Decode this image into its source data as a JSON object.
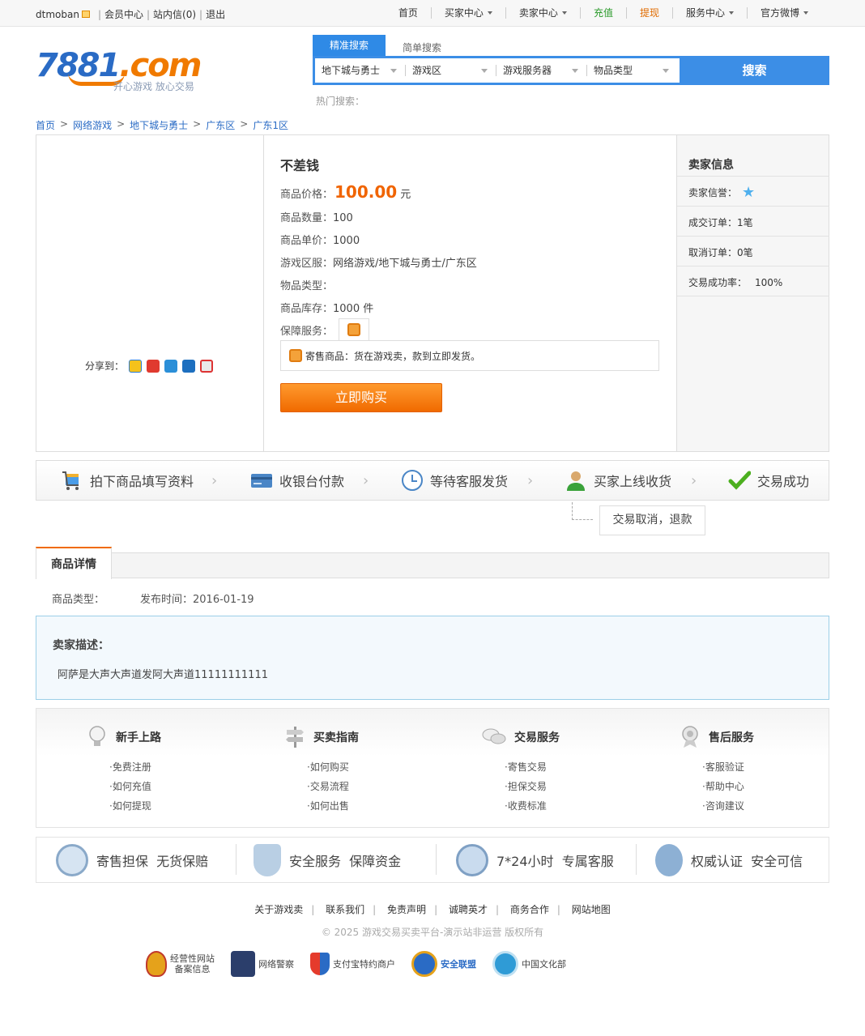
{
  "topbar": {
    "username": "dtmoban",
    "member_center": "会员中心",
    "messages": "站内信(0)",
    "logout": "退出",
    "nav": [
      {
        "label": "首页",
        "dropdown": false
      },
      {
        "label": "买家中心",
        "dropdown": true
      },
      {
        "label": "卖家中心",
        "dropdown": true
      },
      {
        "label": "充值",
        "dropdown": false,
        "color": "#2a9a2a"
      },
      {
        "label": "提现",
        "dropdown": false,
        "color": "#e06b00"
      },
      {
        "label": "服务中心",
        "dropdown": true
      },
      {
        "label": "官方微博",
        "dropdown": true
      }
    ]
  },
  "logo": {
    "brand_number": "7881",
    "brand_suffix": ".com",
    "slogan": "开心游戏 放心交易"
  },
  "search": {
    "tab_precise": "精准搜索",
    "tab_simple": "简单搜索",
    "fields": [
      "地下城与勇士",
      "游戏区",
      "游戏服务器",
      "物品类型"
    ],
    "button": "搜索",
    "hot_label": "热门搜索："
  },
  "breadcrumb": [
    "首页",
    "网络游戏",
    "地下城与勇士",
    "广东区",
    "广东1区"
  ],
  "product": {
    "share_label": "分享到：",
    "title": "不差钱",
    "price_label": "商品价格：",
    "price": "100.00",
    "price_unit": "元",
    "quantity_label": "商品数量：",
    "quantity": "100",
    "unit_price_label": "商品单价：",
    "unit_price": "1000",
    "server_label": "游戏区服：",
    "server": "网络游戏/地下城与勇士/广东区",
    "item_type_label": "物品类型：",
    "item_type": "",
    "stock_label": "商品库存：",
    "stock": "1000 件",
    "guarantee_label": "保障服务：",
    "guarantee_text": "寄售商品：货在游戏卖，款到立即发货。",
    "buy_button": "立即购买"
  },
  "seller": {
    "title": "卖家信息",
    "credit_label": "卖家信誉：",
    "orders": "成交订单：1笔",
    "cancelled": "取消订单：0笔",
    "success_rate_label": "交易成功率：",
    "success_rate": "100%"
  },
  "steps": [
    "拍下商品填写资料",
    "收银台付款",
    "等待客服发货",
    "买家上线收货",
    "交易成功"
  ],
  "cancel_step": "交易取消，退款",
  "detail": {
    "tab": "商品详情",
    "item_type_label": "商品类型：",
    "publish_time": "发布时间：2016-01-19",
    "desc_title": "卖家描述：",
    "desc_text": "阿萨是大声大声道发阿大声道11111111111"
  },
  "help": [
    {
      "title": "新手上路",
      "items": [
        "免费注册",
        "如何充值",
        "如何提现"
      ]
    },
    {
      "title": "买卖指南",
      "items": [
        "如何购买",
        "交易流程",
        "如何出售"
      ]
    },
    {
      "title": "交易服务",
      "items": [
        "寄售交易",
        "担保交易",
        "收费标准"
      ]
    },
    {
      "title": "售后服务",
      "items": [
        "客服验证",
        "帮助中心",
        "咨询建议"
      ]
    }
  ],
  "guarantees": [
    {
      "icon": "compensation-icon",
      "text": "寄售担保  无货保赔"
    },
    {
      "icon": "shield-icon",
      "text": "安全服务  保障资金"
    },
    {
      "icon": "service-clock-icon",
      "text": "7*24小时  专属客服"
    },
    {
      "icon": "certified-medal-icon",
      "text": "权威认证  安全可信"
    }
  ],
  "footer": {
    "links": [
      "关于游戏卖",
      "联系我们",
      "免责声明",
      "诚聘英才",
      "商务合作",
      "网站地图"
    ],
    "copyright": "© 2025 游戏交易买卖平台-演示站非运营 版权所有",
    "badges": [
      "经营性网站\n备案信息",
      "网络警察",
      "支付宝特约商户",
      "安全联盟",
      "中国文化部"
    ]
  }
}
